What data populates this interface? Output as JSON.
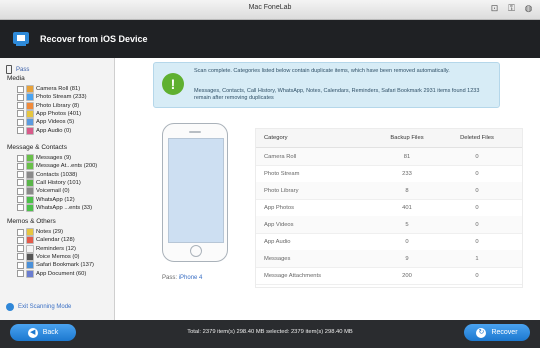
{
  "titlebar": {
    "title": "Mac FoneLab"
  },
  "header": {
    "title": "Recover from iOS Device"
  },
  "sidebar": {
    "device": "Pass",
    "sections": [
      {
        "title": "Media",
        "items": [
          {
            "label": "Camera Roll (81)",
            "color": "#e7a23a"
          },
          {
            "label": "Photo Stream (233)",
            "color": "#4aa3f0"
          },
          {
            "label": "Photo Library (8)",
            "color": "#f08a3a"
          },
          {
            "label": "App Photos (401)",
            "color": "#e6c640"
          },
          {
            "label": "App Videos (5)",
            "color": "#5a9be0"
          },
          {
            "label": "App Audio (0)",
            "color": "#d85b8a"
          }
        ]
      },
      {
        "title": "Message & Contacts",
        "items": [
          {
            "label": "Messages (9)",
            "color": "#69c04a"
          },
          {
            "label": "Message At...ents (200)",
            "color": "#69c04a"
          },
          {
            "label": "Contacts (1038)",
            "color": "#8a8a8a"
          },
          {
            "label": "Call History (101)",
            "color": "#5ab54a"
          },
          {
            "label": "Voicemail (0)",
            "color": "#8a8a8a"
          },
          {
            "label": "WhatsApp (12)",
            "color": "#4cc14a"
          },
          {
            "label": "WhatsApp ...ents (33)",
            "color": "#4cc14a"
          }
        ]
      },
      {
        "title": "Memos & Others",
        "items": [
          {
            "label": "Notes (29)",
            "color": "#e6c640"
          },
          {
            "label": "Calendar (128)",
            "color": "#e45a4a"
          },
          {
            "label": "Reminders (12)",
            "color": "#f4f4f4"
          },
          {
            "label": "Voice Memos (0)",
            "color": "#555555"
          },
          {
            "label": "Safari Bookmark (137)",
            "color": "#4a90d9"
          },
          {
            "label": "App Document (60)",
            "color": "#6a7dd0"
          }
        ]
      }
    ],
    "exit_label": "Exit Scanning Mode"
  },
  "notice": {
    "line1": "Scan complete. Categories listed below contain duplicate items, which have been removed automatically.",
    "line2": "Messages, Contacts, Call History, WhatsApp, Notes, Calendars, Reminders, Safari Bookmark 2931 items found 1233 remain after removing duplicates"
  },
  "device_info": {
    "label": "Pass:",
    "model": "iPhone 4"
  },
  "table": {
    "headers": [
      "Category",
      "Backup Files",
      "Deleted Files"
    ],
    "rows": [
      [
        "Camera Roll",
        "81",
        "0"
      ],
      [
        "Photo Stream",
        "233",
        "0"
      ],
      [
        "Photo Library",
        "8",
        "0"
      ],
      [
        "App Photos",
        "401",
        "0"
      ],
      [
        "App Videos",
        "5",
        "0"
      ],
      [
        "App Audio",
        "0",
        "0"
      ],
      [
        "Messages",
        "9",
        "1"
      ],
      [
        "Message Attachments",
        "200",
        "0"
      ]
    ]
  },
  "footer": {
    "back_label": "Back",
    "total": "Total: 2379 item(s) 298.40 MB  selected: 2379 item(s) 298.40 MB",
    "recover_label": "Recover"
  }
}
